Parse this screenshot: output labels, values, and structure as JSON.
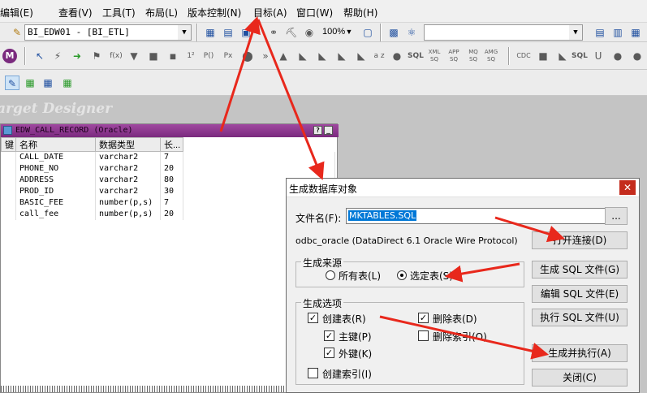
{
  "menu": {
    "items": [
      "编辑(E)",
      "查看(V)",
      "工具(T)",
      "布局(L)",
      "版本控制(N)",
      "目标(A)",
      "窗口(W)",
      "帮助(H)"
    ]
  },
  "toolbar1": {
    "combo_value": "BI_EDW01 - [BI_ETL]",
    "zoom": "100%"
  },
  "toolbar2": {
    "labels": [
      "f(x)",
      "SQL",
      "XML SQ",
      "APP SQ",
      "MQ SQ",
      "AMG SQ",
      "SQL"
    ]
  },
  "designer": {
    "title": "arget Designer"
  },
  "target": {
    "title": "EDW_CALL_RECORD (Oracle)",
    "columns": [
      "键",
      "名称",
      "数据类型",
      "长..."
    ],
    "rows": [
      {
        "name": "CALL_DATE",
        "type": "varchar2",
        "len": "7"
      },
      {
        "name": "PHONE_NO",
        "type": "varchar2",
        "len": "20"
      },
      {
        "name": "ADDRESS",
        "type": "varchar2",
        "len": "80"
      },
      {
        "name": "PROD_ID",
        "type": "varchar2",
        "len": "30"
      },
      {
        "name": "BASIC_FEE",
        "type": "number(p,s)",
        "len": "7"
      },
      {
        "name": "call_fee",
        "type": "number(p,s)",
        "len": "20"
      }
    ]
  },
  "dialog": {
    "title": "生成数据库对象",
    "filename_label": "文件名(F):",
    "filename_value": "MKTABLES.SQL",
    "browse": "...",
    "connection": "odbc_oracle (DataDirect 6.1 Oracle Wire Protocol)",
    "open_conn": "打开连接(D)",
    "source_group": "生成来源",
    "all_tables": "所有表(L)",
    "selected_tables": "选定表(S)",
    "options_group": "生成选项",
    "create_table": "创建表(R)",
    "primary_key": "主键(P)",
    "foreign_key": "外键(K)",
    "create_index": "创建索引(I)",
    "drop_table": "删除表(D)",
    "drop_index": "删除索引(O)",
    "gen_sql": "生成 SQL 文件(G)",
    "edit_sql": "编辑 SQL 文件(E)",
    "exec_sql": "执行 SQL 文件(U)",
    "gen_exec": "生成并执行(A)",
    "close": "关闭(C)",
    "checks": {
      "create_table": true,
      "primary_key": true,
      "foreign_key": true,
      "create_index": false,
      "drop_table": true,
      "drop_index": false
    },
    "source_selected": "selected"
  },
  "colors": {
    "arrow": "#e8281c",
    "target_header": "#8a3890",
    "close_btn": "#c42b1c"
  }
}
